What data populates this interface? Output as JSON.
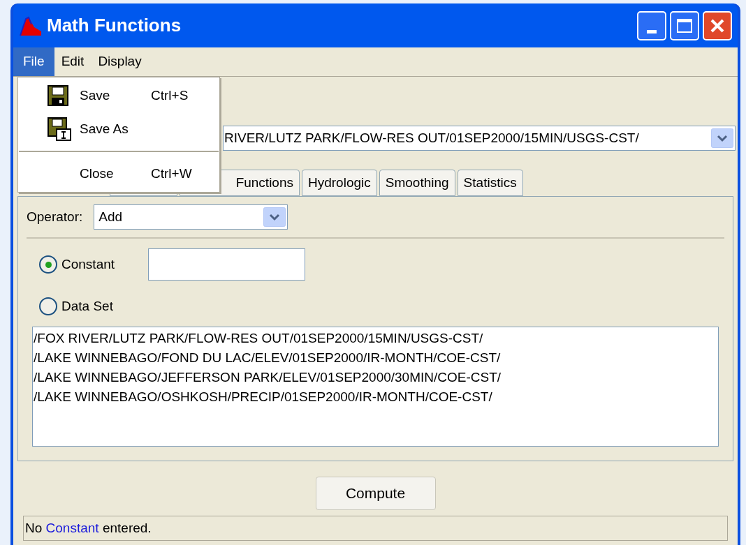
{
  "window": {
    "title": "Math Functions"
  },
  "menu_bar": [
    {
      "label": "File",
      "selected": true
    },
    {
      "label": "Edit",
      "selected": false
    },
    {
      "label": "Display",
      "selected": false
    }
  ],
  "file_menu": [
    {
      "kind": "save_item",
      "label": "Save",
      "shortcut": "Ctrl+S"
    },
    {
      "kind": "save_as_item",
      "label": "Save As"
    },
    {
      "kind": "separator"
    },
    {
      "kind": "item",
      "label": "Close",
      "shortcut": "Ctrl+W"
    }
  ],
  "dataset_combo": {
    "value": "RIVER/LUTZ PARK/FLOW-RES OUT/01SEP2000/15MIN/USGS-CST/"
  },
  "tabs": [
    {
      "selected": false
    },
    {
      "label": "Functions",
      "selected": false
    },
    {
      "label": "Hydrologic",
      "selected": false
    },
    {
      "label": "Smoothing",
      "selected": false
    },
    {
      "label": "Statistics",
      "selected": false
    }
  ],
  "operator": {
    "label": "Operator:",
    "value": "Add"
  },
  "options": [
    {
      "label": "Constant",
      "selected": true,
      "kind": "with_field"
    },
    {
      "label": "Data Set",
      "selected": false,
      "kind": "plain"
    }
  ],
  "datasets": [
    "/FOX RIVER/LUTZ PARK/FLOW-RES OUT/01SEP2000/15MIN/USGS-CST/",
    "/LAKE WINNEBAGO/FOND DU LAC/ELEV/01SEP2000/IR-MONTH/COE-CST/",
    "/LAKE WINNEBAGO/JEFFERSON PARK/ELEV/01SEP2000/30MIN/COE-CST/",
    "/LAKE WINNEBAGO/OSHKOSH/PRECIP/01SEP2000/IR-MONTH/COE-CST/"
  ],
  "compute_button": "Compute",
  "status_bar": [
    {
      "text": "No",
      "kind": "plain"
    },
    {
      "text": "Constant",
      "kind": "link"
    },
    {
      "text": "entered.",
      "kind": "plain"
    }
  ]
}
